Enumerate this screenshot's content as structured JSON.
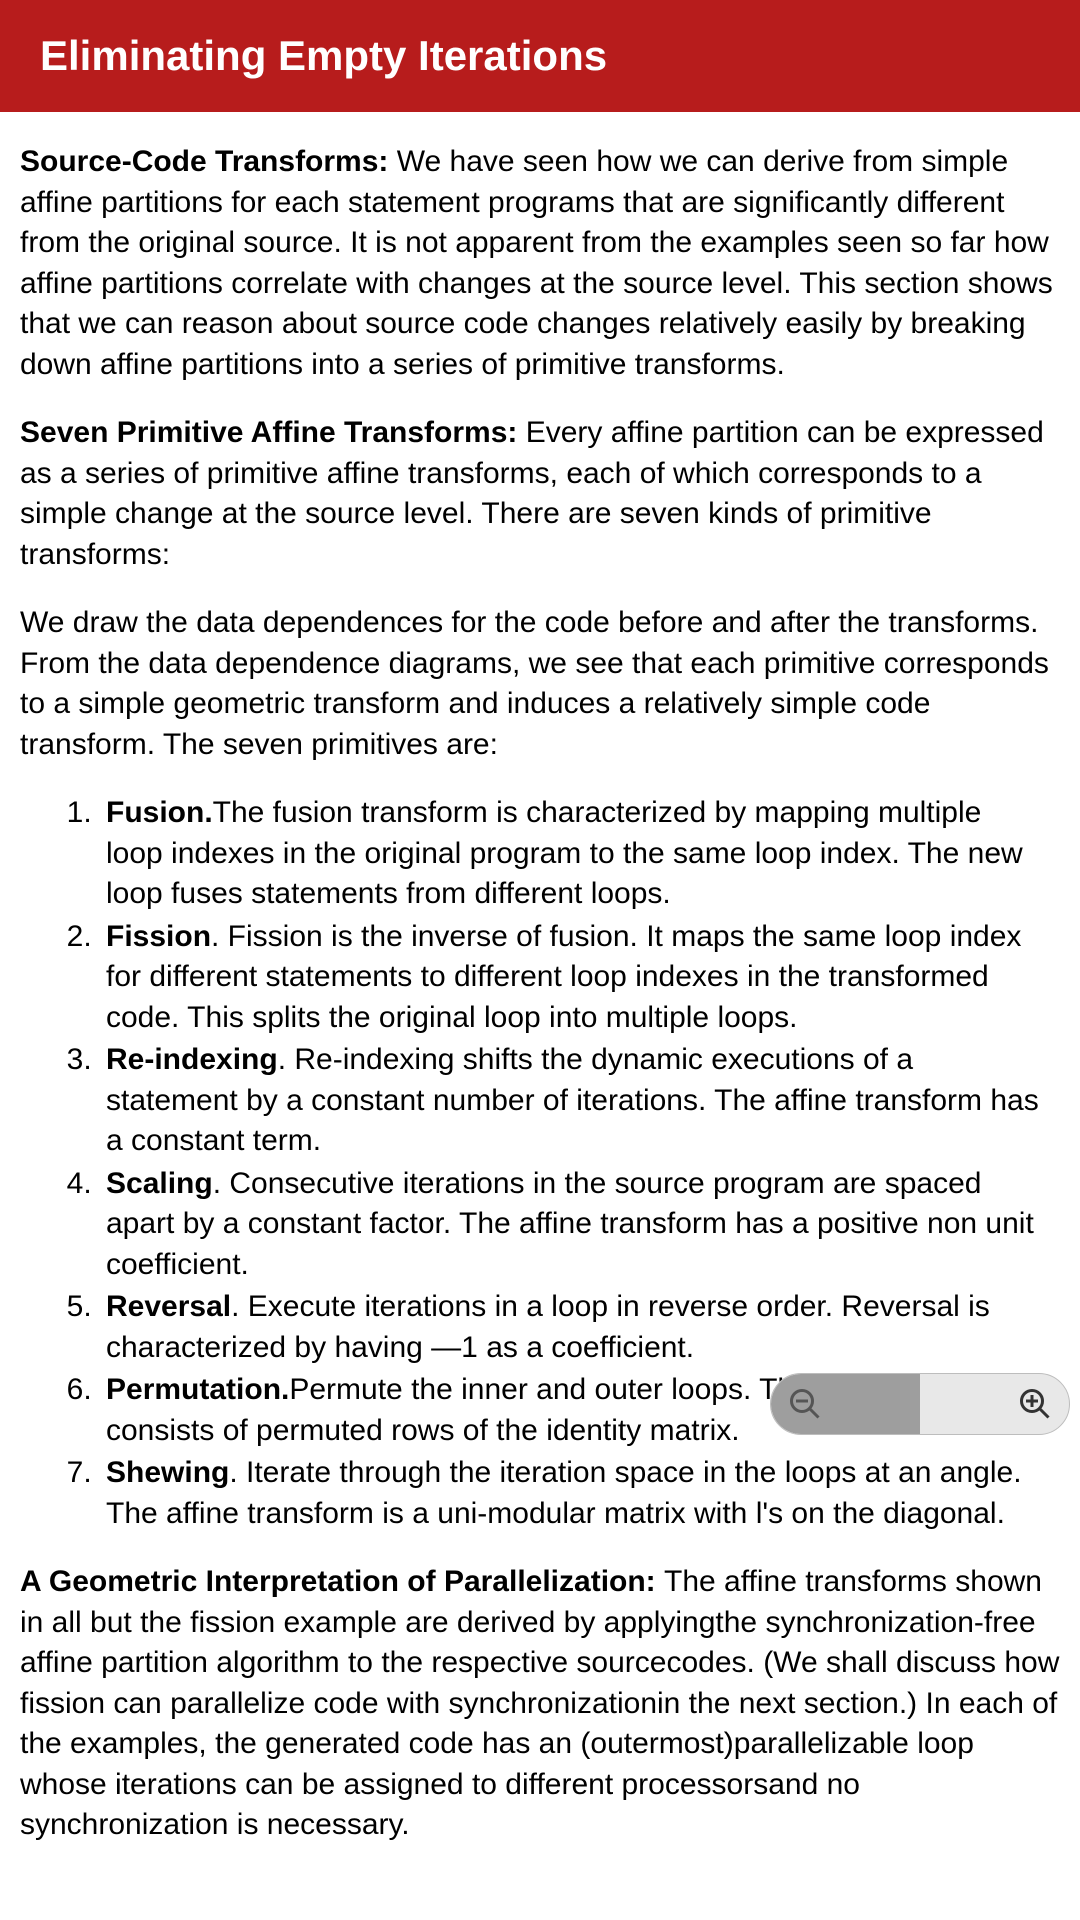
{
  "header": {
    "title": "Eliminating Empty Iterations"
  },
  "sections": {
    "source_code_label": "Source-Code Transforms: ",
    "source_code_body": "We have seen how we can derive from simple affine partitions for each statement programs that are significantly different from the original source. It is not apparent from the examples seen so far how affine partitions correlate with changes at the source level. This section shows that we can reason about source code changes relatively easily by breaking down affine partitions into a series of primitive transforms.",
    "seven_label": "Seven Primitive Affine Transforms: ",
    "seven_body": "Every affine partition can be expressed as a series of primitive affine transforms, each of which corresponds to a simple change at the source level. There are seven kinds of primitive transforms:",
    "draw_body": "We draw the data dependences for the code before and after the transforms. From the data dependence diagrams, we see that each primitive corresponds to a simple geometric transform and induces a relatively simple code transform. The seven primitives are:",
    "primitives": [
      {
        "name": "Fusion.",
        "desc": "The fusion transform is characterized by mapping multiple loop indexes in the original program to the same loop index. The new loop fuses statements from different loops."
      },
      {
        "name": "Fission",
        "desc": ". Fission is the inverse of fusion. It maps the same loop index for different statements to different loop indexes in the transformed code. This splits the original loop into multiple loops."
      },
      {
        "name": "Re-indexing",
        "desc": ". Re-indexing shifts the dynamic executions of a statement by a constant number of iterations. The affine transform has a constant term."
      },
      {
        "name": "Scaling",
        "desc": ". Consecutive iterations in the source program are spaced apart by a constant factor. The affine transform has a positive non unit coefficient."
      },
      {
        "name": "Reversal",
        "desc": ". Execute iterations in a loop in reverse order. Reversal is characterized by having —1 as a coefficient."
      },
      {
        "name": "Permutation.",
        "desc": "Permute the inner and outer loops. The affine transform consists of permuted rows of the identity matrix."
      },
      {
        "name": "Shewing",
        "desc": ". Iterate through the iteration space in the loops at an angle. The affine transform is a uni-modular matrix with l's on the diagonal."
      }
    ],
    "geo_label": "A Geometric Interpretation of Parallelization: ",
    "geo_body": "The affine transforms shown in all but the fission example are derived by applyingthe synchronization-free affine partition algorithm to the respective sourcecodes. (We shall discuss how fission can parallelize code with synchronizationin the next section.) In each of the examples, the generated code has an (outermost)parallelizable loop whose iterations can be assigned to different processorsand no synchronization is necessary."
  }
}
